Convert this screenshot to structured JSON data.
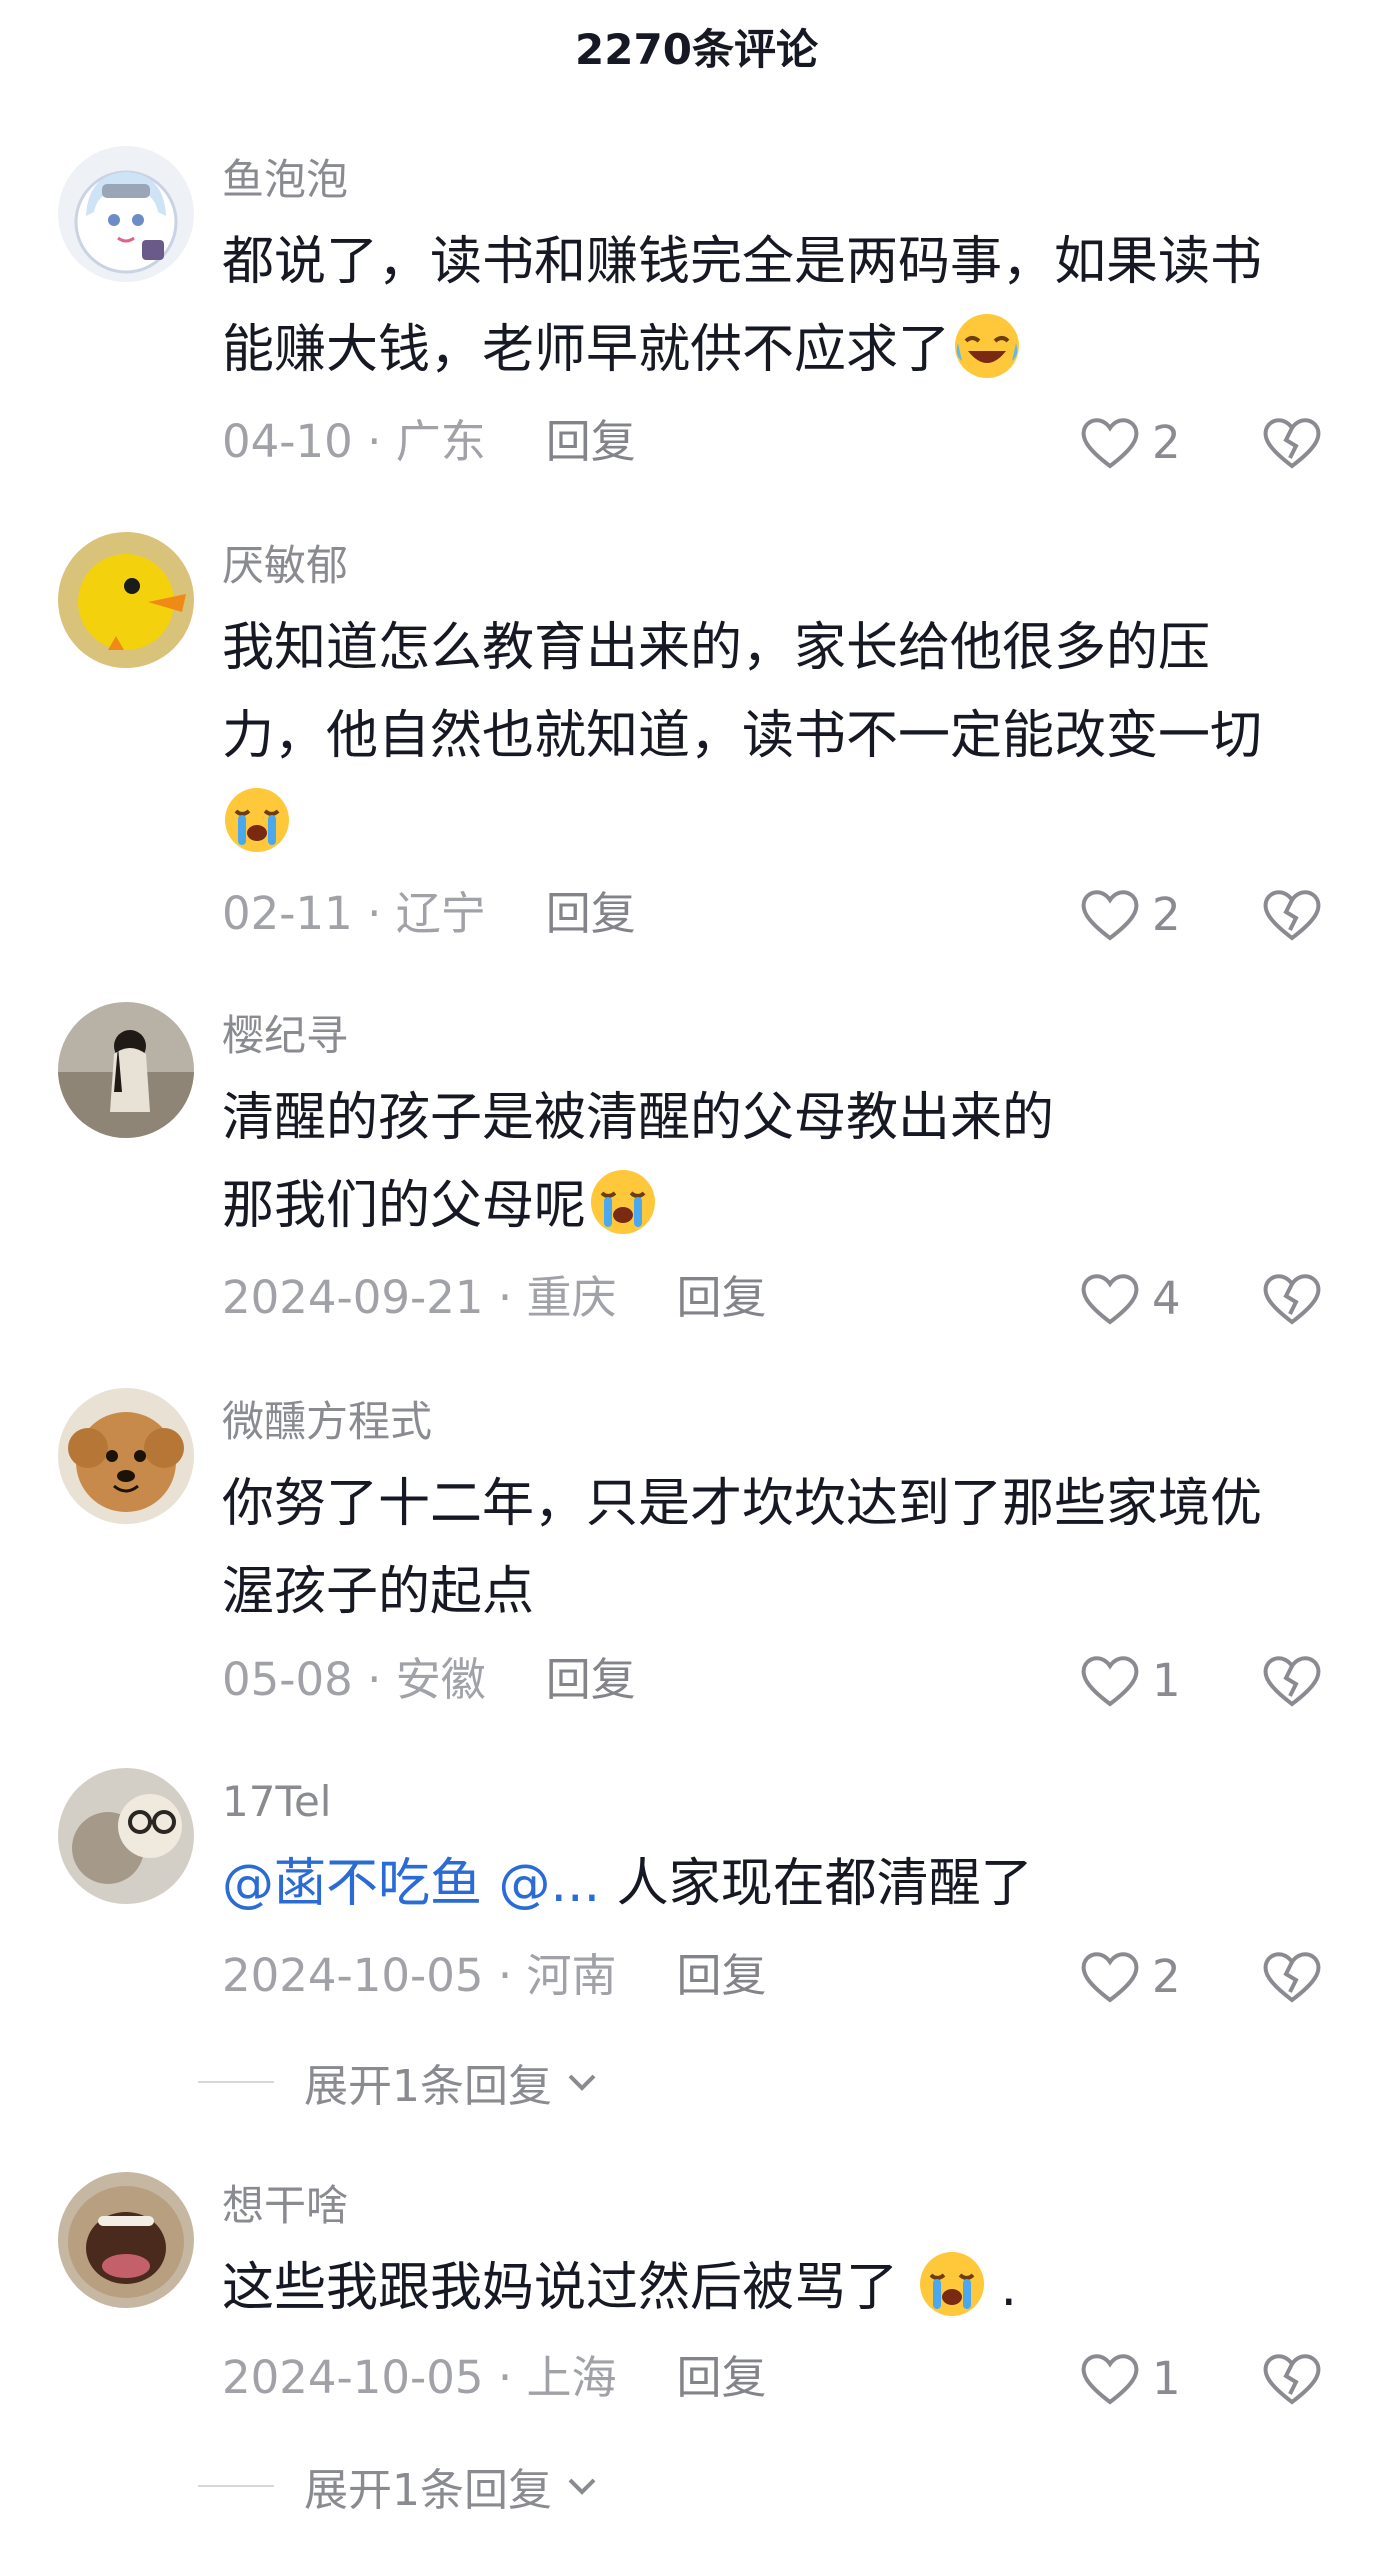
{
  "header": {
    "title": "2270条评论"
  },
  "colors": {
    "text": "#161823",
    "meta": "#a1a2a7",
    "mention": "#2a6bd6",
    "divider": "#d6d7db"
  },
  "comments": [
    {
      "username": "鱼泡泡",
      "avatar_icon": "anime-girl-avatar",
      "lines": [
        "都说了，读书和赚钱完全是两码事，如果读书",
        "能赚大钱，老师早就供不应求了"
      ],
      "emoji": "laugh-cry-emoji",
      "date": "04-10",
      "location": "广东",
      "reply_label": "回复",
      "likes": "2"
    },
    {
      "username": "厌敏郁",
      "avatar_icon": "yellow-duck-avatar",
      "lines": [
        "我知道怎么教育出来的，家长给他很多的压",
        "力，他自然也就知道，读书不一定能改变一切"
      ],
      "emoji": "crying-emoji",
      "date": "02-11",
      "location": "辽宁",
      "reply_label": "回复",
      "likes": "2"
    },
    {
      "username": "樱纪寻",
      "avatar_icon": "girl-photo-avatar",
      "lines": [
        "清醒的孩子是被清醒的父母教出来的",
        "那我们的父母呢"
      ],
      "emoji": "crying-emoji",
      "date": "2024-09-21",
      "location": "重庆",
      "reply_label": "回复",
      "likes": "4"
    },
    {
      "username": "微醺方程式",
      "avatar_icon": "puppy-avatar",
      "lines": [
        "你努了十二年，只是才坎坎达到了那些家境优",
        "渥孩子的起点"
      ],
      "date": "05-08",
      "location": "安徽",
      "reply_label": "回复",
      "likes": "1"
    },
    {
      "username": "17Tel",
      "avatar_icon": "cat-glasses-avatar",
      "mention": "@菡不吃鱼 @...",
      "lines": [
        " 人家现在都清醒了"
      ],
      "date": "2024-10-05",
      "location": "河南",
      "reply_label": "回复",
      "likes": "2",
      "expand_label": "展开1条回复"
    },
    {
      "username": "想干啥",
      "avatar_icon": "screaming-face-avatar",
      "lines": [
        "这些我跟我妈说过然后被骂了 "
      ],
      "emoji": "crying-emoji",
      "trailing": ".",
      "date": "2024-10-05",
      "location": "上海",
      "reply_label": "回复",
      "likes": "1",
      "expand_label": "展开1条回复"
    }
  ]
}
